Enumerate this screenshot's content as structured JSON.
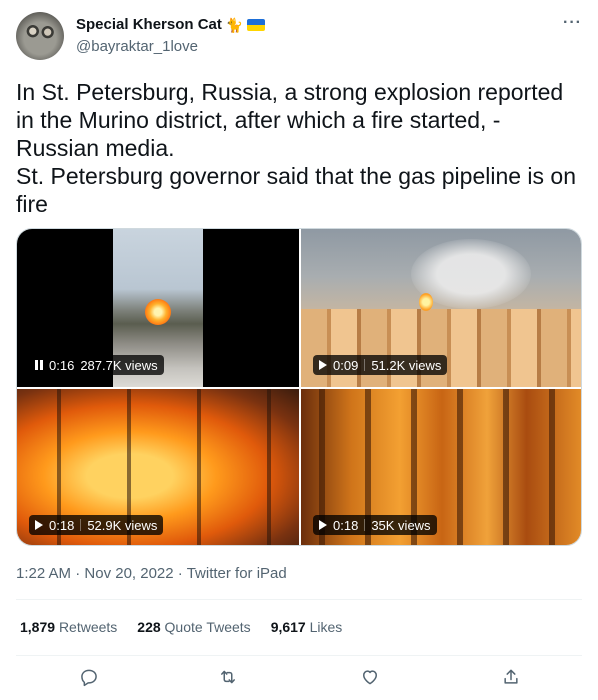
{
  "user": {
    "display_name": "Special Kherson Cat",
    "handle": "@bayraktar_1love",
    "name_emoji": "🐈",
    "flag_colors": {
      "top": "#1d6fd8",
      "bottom": "#ffd500"
    }
  },
  "tweet": {
    "text_line_1": "In St. Petersburg, Russia, a strong explosion reported in the Murino district, after which a fire started, - Russian media.",
    "text_line_2": "St. Petersburg governor said that the gas pipeline is on fire"
  },
  "media": [
    {
      "icon": "pause-icon",
      "duration": "0:16",
      "views": "287.7K views"
    },
    {
      "icon": "play-icon",
      "duration": "0:09",
      "views": "51.2K views"
    },
    {
      "icon": "play-icon",
      "duration": "0:18",
      "views": "52.9K views"
    },
    {
      "icon": "play-icon",
      "duration": "0:18",
      "views": "35K views"
    }
  ],
  "meta": {
    "time": "1:22 AM",
    "date": "Nov 20, 2022",
    "source": "Twitter for iPad"
  },
  "stats": {
    "retweets_count": "1,879",
    "retweets_label": "Retweets",
    "quotes_count": "228",
    "quotes_label": "Quote Tweets",
    "likes_count": "9,617",
    "likes_label": "Likes"
  },
  "more_label": "···",
  "colors": {
    "text": "#0f1419",
    "secondary": "#536471",
    "divider": "#eff3f4"
  }
}
